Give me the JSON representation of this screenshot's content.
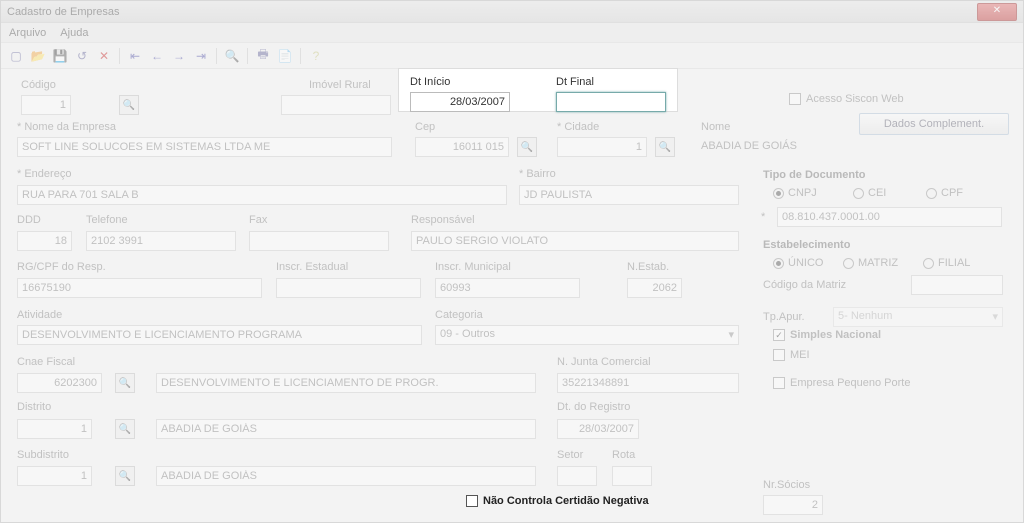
{
  "window": {
    "title": "Cadastro de Empresas"
  },
  "menu": {
    "arquivo": "Arquivo",
    "ajuda": "Ajuda"
  },
  "labels": {
    "codigo": "Código",
    "imovel_rural": "Imóvel Rural",
    "dt_inicio": "Dt Início",
    "dt_final": "Dt Final",
    "nome_empresa": "Nome da Empresa",
    "cep": "Cep",
    "cidade": "Cidade",
    "nome": "Nome",
    "endereco": "Endereço",
    "bairro": "Bairro",
    "ddd": "DDD",
    "telefone": "Telefone",
    "fax": "Fax",
    "responsavel": "Responsável",
    "rgcpf": "RG/CPF do Resp.",
    "inscr_est": "Inscr. Estadual",
    "inscr_mun": "Inscr. Municipal",
    "n_estab": "N.Estab.",
    "atividade": "Atividade",
    "categoria": "Categoria",
    "cnae": "Cnae Fiscal",
    "n_junta": "N. Junta Comercial",
    "distrito": "Distrito",
    "dt_registro": "Dt. do Registro",
    "subdistrito": "Subdistrito",
    "setor": "Setor",
    "rota": "Rota",
    "acesso_siscon": "Acesso Siscon Web",
    "dados_complement": "Dados Complement.",
    "tipo_doc": "Tipo de Documento",
    "cnpj": "CNPJ",
    "cei": "CEI",
    "cpf": "CPF",
    "estabelecimento": "Estabelecimento",
    "unico": "ÚNICO",
    "matriz": "MATRIZ",
    "filial": "FILIAL",
    "codigo_matriz": "Código da Matriz",
    "tp_apur": "Tp.Apur.",
    "simples": "Simples Nacional",
    "mei": "MEI",
    "epp": "Empresa Pequeno Porte",
    "nr_socios": "Nr.Sócios",
    "nao_controla": "Não Controla Certidão Negativa"
  },
  "values": {
    "codigo": "1",
    "dt_inicio": "28/03/2007",
    "dt_final": "",
    "nome_empresa": "SOFT LINE SOLUCOES EM SISTEMAS LTDA ME",
    "cep": "16011 015",
    "cidade": "1",
    "nome_cidade": "ABADIA DE GOIÁS",
    "endereco": "RUA PARA 701 SALA B",
    "bairro": "JD PAULISTA",
    "ddd": "18",
    "telefone": "2102 3991",
    "fax": "",
    "responsavel": "PAULO SERGIO VIOLATO",
    "rgcpf": "16675190",
    "inscr_est": "",
    "inscr_mun": "60993",
    "n_estab": "2062",
    "atividade": "DESENVOLVIMENTO E LICENCIAMENTO PROGRAMA",
    "categoria": "09 - Outros",
    "cnae": "6202300",
    "cnae_desc": "DESENVOLVIMENTO E LICENCIAMENTO DE PROGR.",
    "n_junta": "35221348891",
    "distrito": "1",
    "distrito_nome": "ABADIA DE GOIÁS",
    "dt_registro": "28/03/2007",
    "subdistrito": "1",
    "subdistrito_nome": "ABADIA DE GOIÁS",
    "setor": "",
    "rota": "",
    "doc_num": "08.810.437.0001.00",
    "doc_asterisk": "*",
    "codigo_matriz": "",
    "tp_apur_val": "5- Nenhum",
    "nr_socios": "2"
  }
}
